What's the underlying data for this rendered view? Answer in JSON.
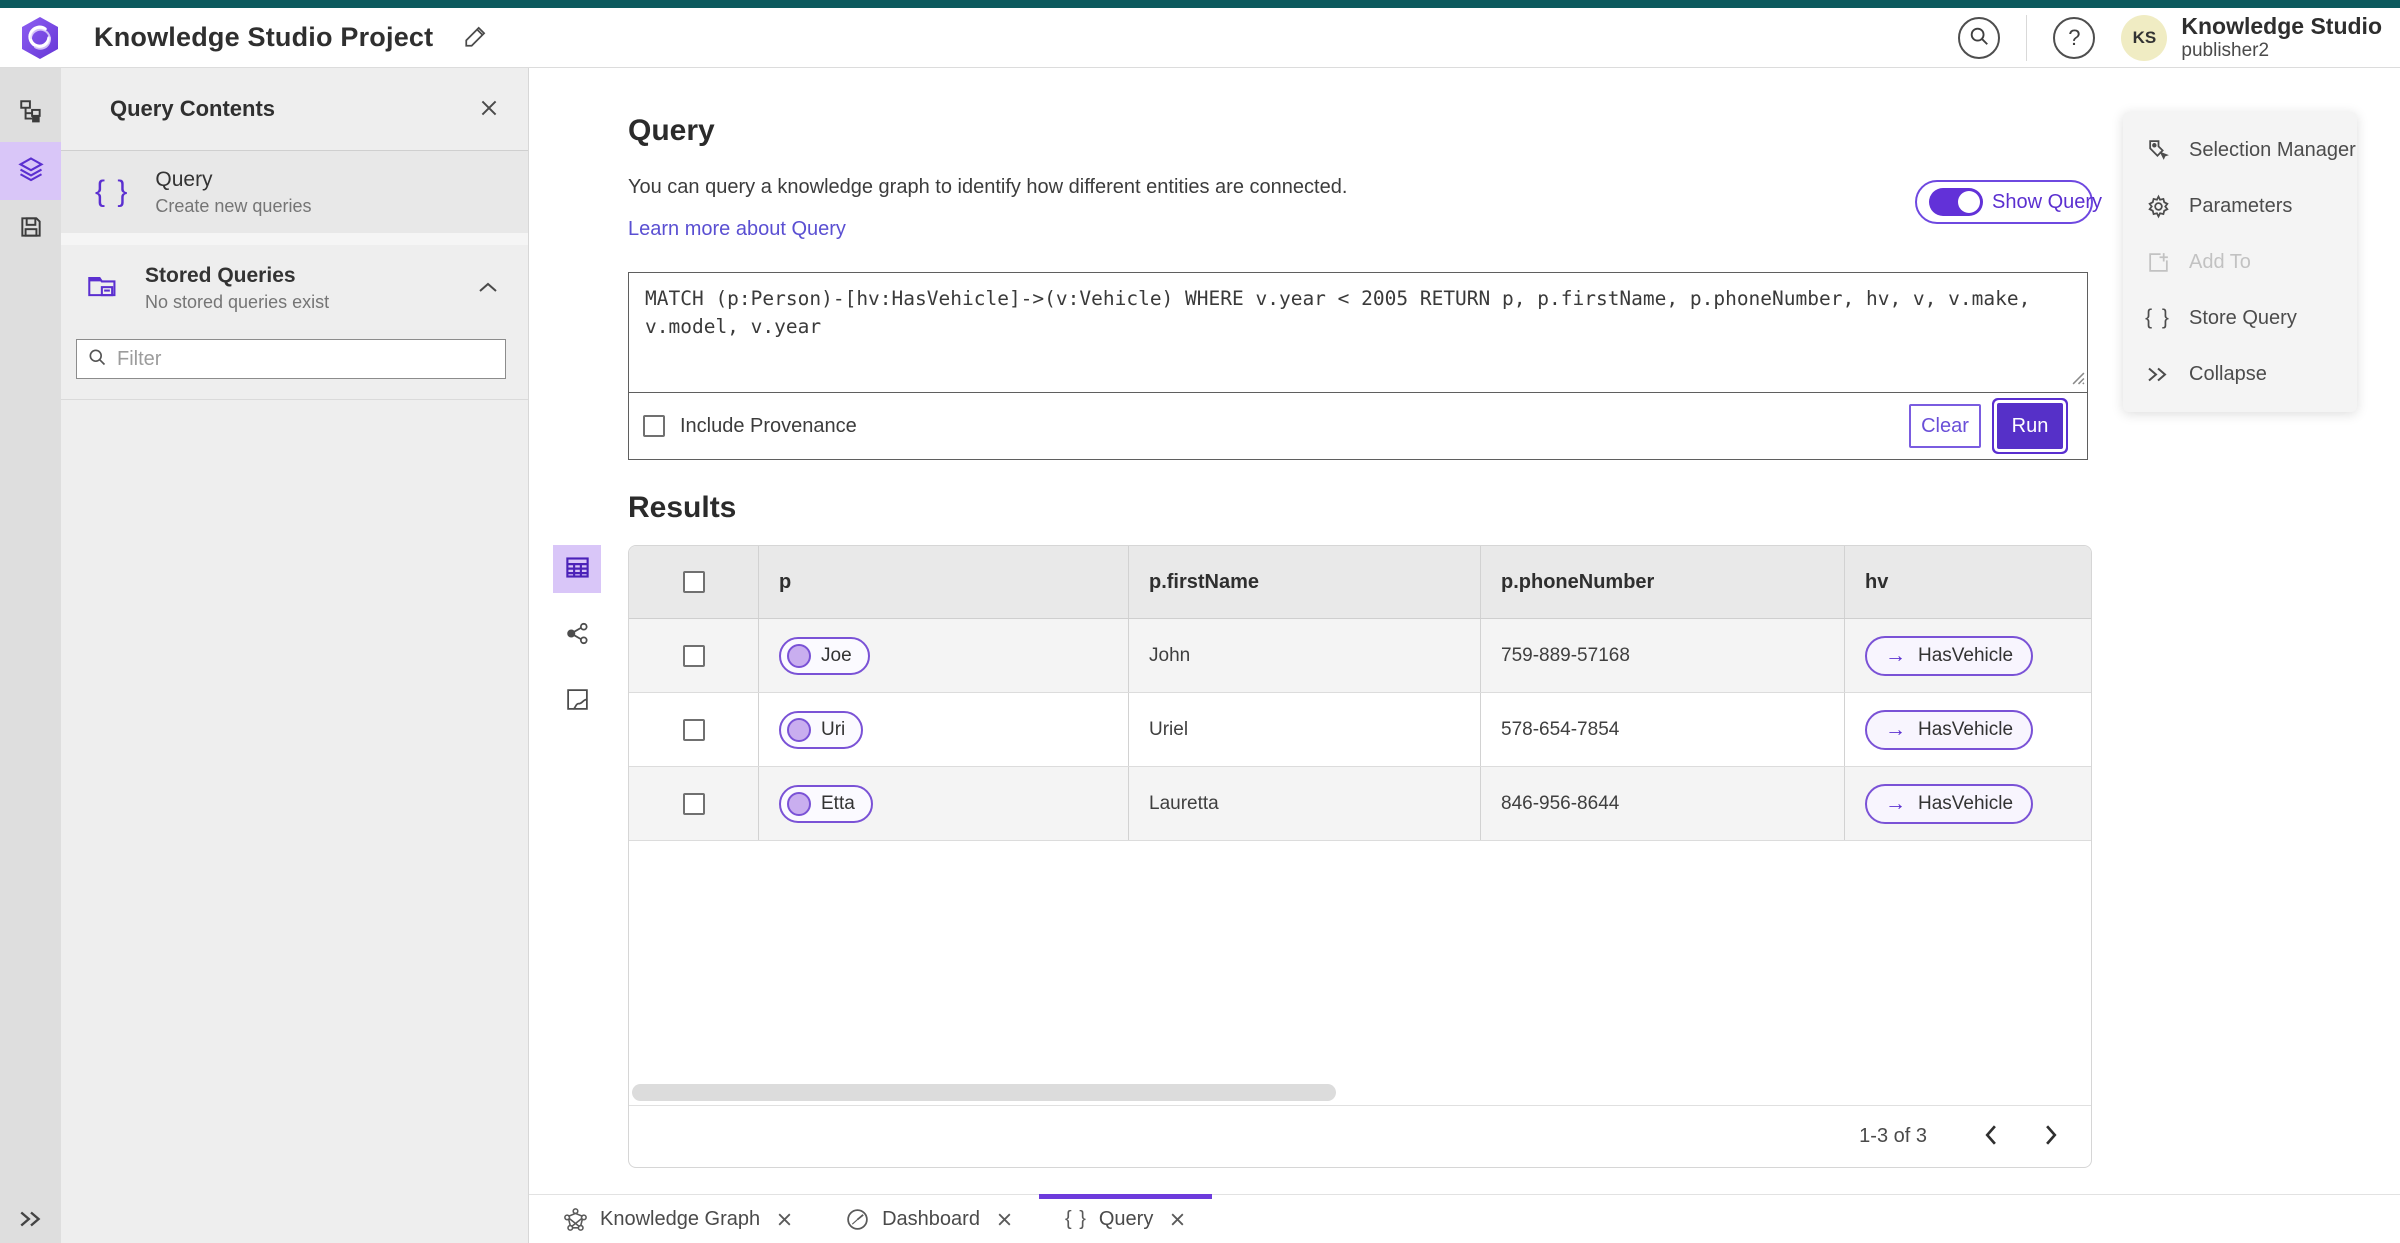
{
  "header": {
    "title": "Knowledge Studio Project",
    "product_name": "Knowledge Studio",
    "user_name": "publisher2",
    "avatar_initials": "KS"
  },
  "panel": {
    "title": "Query Contents",
    "query_item": {
      "title": "Query",
      "subtitle": "Create new queries"
    },
    "stored_queries": {
      "title": "Stored Queries",
      "subtitle": "No stored queries exist"
    },
    "filter": {
      "placeholder": "Filter"
    }
  },
  "query": {
    "heading": "Query",
    "description": "You can query a knowledge graph to identify how different entities are connected.",
    "learn_more": "Learn more about Query",
    "show_query": "Show Query",
    "text": "MATCH (p:Person)-[hv:HasVehicle]->(v:Vehicle) WHERE v.year < 2005 RETURN p, p.firstName, p.phoneNumber, hv, v, v.make, v.model, v.year",
    "include_provenance": "Include Provenance",
    "clear": "Clear",
    "run": "Run"
  },
  "results": {
    "heading": "Results",
    "columns": [
      "p",
      "p.firstName",
      "p.phoneNumber",
      "hv"
    ],
    "rows": [
      {
        "p": "Joe",
        "firstName": "John",
        "phoneNumber": "759-889-57168",
        "hv": "HasVehicle",
        "arrow": "→"
      },
      {
        "p": "Uri",
        "firstName": "Uriel",
        "phoneNumber": "578-654-7854",
        "hv": "HasVehicle",
        "arrow": "→"
      },
      {
        "p": "Etta",
        "firstName": "Lauretta",
        "phoneNumber": "846-956-8644",
        "hv": "HasVehicle",
        "arrow": "→"
      }
    ],
    "pagination": "1-3 of 3"
  },
  "actions_panel": {
    "items": [
      {
        "label": "Selection Manager"
      },
      {
        "label": "Parameters"
      },
      {
        "label": "Add To"
      },
      {
        "label": "Store Query"
      },
      {
        "label": "Collapse"
      }
    ]
  },
  "tabs": [
    {
      "label": "Knowledge Graph"
    },
    {
      "label": "Dashboard"
    },
    {
      "label": "Query"
    }
  ],
  "misc": {
    "braces_glyph": "{ }",
    "collapse_glyph": "»"
  },
  "colors": {
    "brand_purple": "#5B2FD1",
    "light_purple": "#D9C6F8",
    "teal_strip": "#0C5A5E",
    "link": "#5A4FD2",
    "avatar_bg": "#F0ECC3"
  }
}
